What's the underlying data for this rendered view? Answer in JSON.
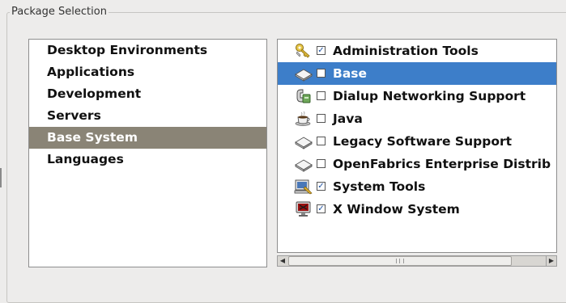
{
  "frame": {
    "title": "Package Selection"
  },
  "categories": [
    {
      "label": "Desktop Environments",
      "selected": false
    },
    {
      "label": "Applications",
      "selected": false
    },
    {
      "label": "Development",
      "selected": false
    },
    {
      "label": "Servers",
      "selected": false
    },
    {
      "label": "Base System",
      "selected": true
    },
    {
      "label": "Languages",
      "selected": false
    }
  ],
  "groups": [
    {
      "label": "Administration Tools",
      "checked": true,
      "selected": false,
      "icon": "keys-icon"
    },
    {
      "label": "Base",
      "checked": false,
      "selected": true,
      "icon": "drive-icon"
    },
    {
      "label": "Dialup Networking Support",
      "checked": false,
      "selected": false,
      "icon": "modem-icon"
    },
    {
      "label": "Java",
      "checked": false,
      "selected": false,
      "icon": "coffee-cup-icon"
    },
    {
      "label": "Legacy Software Support",
      "checked": false,
      "selected": false,
      "icon": "drive-icon"
    },
    {
      "label": "OpenFabrics Enterprise Distrib",
      "checked": false,
      "selected": false,
      "icon": "drive-icon"
    },
    {
      "label": "System Tools",
      "checked": true,
      "selected": false,
      "icon": "computer-tools-icon"
    },
    {
      "label": "X Window System",
      "checked": true,
      "selected": false,
      "icon": "monitor-icon"
    }
  ],
  "colors": {
    "selection_category": "#8a8476",
    "selection_group": "#3d7ec9",
    "background": "#edeceb"
  }
}
